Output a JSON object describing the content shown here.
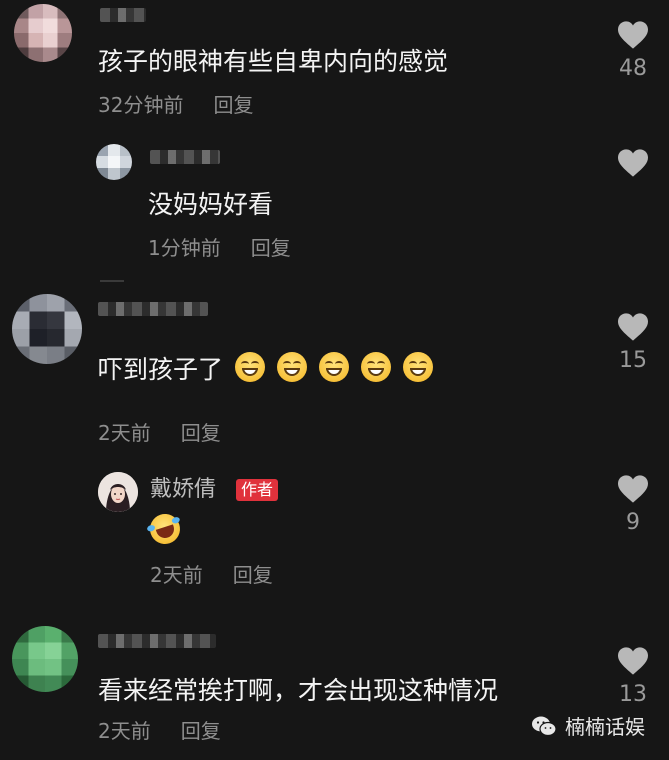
{
  "comments": [
    {
      "text": "孩子的眼神有些自卑内向的感觉",
      "time": "32分钟前",
      "reply_label": "回复",
      "likes": "48"
    },
    {
      "text": "没妈妈好看",
      "time": "1分钟前",
      "reply_label": "回复",
      "likes": ""
    },
    {
      "text": "吓到孩子了",
      "emoji_count": 5,
      "time": "2天前",
      "reply_label": "回复",
      "likes": "15"
    },
    {
      "author": "戴娇倩",
      "badge": "作者",
      "time": "2天前",
      "reply_label": "回复",
      "likes": "9"
    },
    {
      "text": "看来经常挨打啊，才会出现这种情况",
      "time": "2天前",
      "reply_label": "回复",
      "likes": "13"
    }
  ],
  "watermark": {
    "text": "楠楠话娱"
  },
  "colors": {
    "background": "#161616",
    "text": "#f4f4f4",
    "meta": "#8e8e8e",
    "heart": "#b8b8b8",
    "author_badge": "#e0323c"
  },
  "icons": [
    "heart-icon",
    "grin-emoji",
    "laugh-tears-emoji",
    "wechat-icon"
  ]
}
